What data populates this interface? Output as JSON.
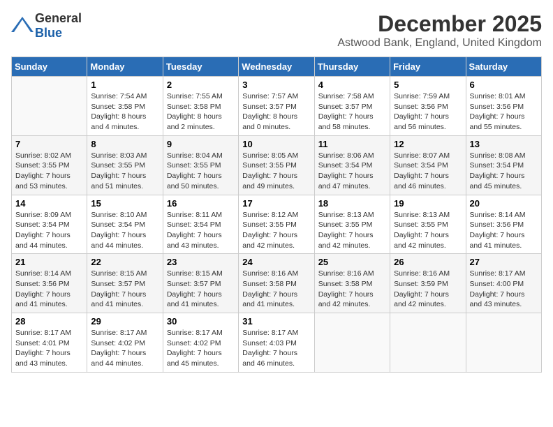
{
  "logo": {
    "general": "General",
    "blue": "Blue"
  },
  "title": {
    "month": "December 2025",
    "location": "Astwood Bank, England, United Kingdom"
  },
  "headers": [
    "Sunday",
    "Monday",
    "Tuesday",
    "Wednesday",
    "Thursday",
    "Friday",
    "Saturday"
  ],
  "rows": [
    [
      {
        "day": "",
        "info": ""
      },
      {
        "day": "1",
        "info": "Sunrise: 7:54 AM\nSunset: 3:58 PM\nDaylight: 8 hours\nand 4 minutes."
      },
      {
        "day": "2",
        "info": "Sunrise: 7:55 AM\nSunset: 3:58 PM\nDaylight: 8 hours\nand 2 minutes."
      },
      {
        "day": "3",
        "info": "Sunrise: 7:57 AM\nSunset: 3:57 PM\nDaylight: 8 hours\nand 0 minutes."
      },
      {
        "day": "4",
        "info": "Sunrise: 7:58 AM\nSunset: 3:57 PM\nDaylight: 7 hours\nand 58 minutes."
      },
      {
        "day": "5",
        "info": "Sunrise: 7:59 AM\nSunset: 3:56 PM\nDaylight: 7 hours\nand 56 minutes."
      },
      {
        "day": "6",
        "info": "Sunrise: 8:01 AM\nSunset: 3:56 PM\nDaylight: 7 hours\nand 55 minutes."
      }
    ],
    [
      {
        "day": "7",
        "info": "Sunrise: 8:02 AM\nSunset: 3:55 PM\nDaylight: 7 hours\nand 53 minutes."
      },
      {
        "day": "8",
        "info": "Sunrise: 8:03 AM\nSunset: 3:55 PM\nDaylight: 7 hours\nand 51 minutes."
      },
      {
        "day": "9",
        "info": "Sunrise: 8:04 AM\nSunset: 3:55 PM\nDaylight: 7 hours\nand 50 minutes."
      },
      {
        "day": "10",
        "info": "Sunrise: 8:05 AM\nSunset: 3:55 PM\nDaylight: 7 hours\nand 49 minutes."
      },
      {
        "day": "11",
        "info": "Sunrise: 8:06 AM\nSunset: 3:54 PM\nDaylight: 7 hours\nand 47 minutes."
      },
      {
        "day": "12",
        "info": "Sunrise: 8:07 AM\nSunset: 3:54 PM\nDaylight: 7 hours\nand 46 minutes."
      },
      {
        "day": "13",
        "info": "Sunrise: 8:08 AM\nSunset: 3:54 PM\nDaylight: 7 hours\nand 45 minutes."
      }
    ],
    [
      {
        "day": "14",
        "info": "Sunrise: 8:09 AM\nSunset: 3:54 PM\nDaylight: 7 hours\nand 44 minutes."
      },
      {
        "day": "15",
        "info": "Sunrise: 8:10 AM\nSunset: 3:54 PM\nDaylight: 7 hours\nand 44 minutes."
      },
      {
        "day": "16",
        "info": "Sunrise: 8:11 AM\nSunset: 3:54 PM\nDaylight: 7 hours\nand 43 minutes."
      },
      {
        "day": "17",
        "info": "Sunrise: 8:12 AM\nSunset: 3:55 PM\nDaylight: 7 hours\nand 42 minutes."
      },
      {
        "day": "18",
        "info": "Sunrise: 8:13 AM\nSunset: 3:55 PM\nDaylight: 7 hours\nand 42 minutes."
      },
      {
        "day": "19",
        "info": "Sunrise: 8:13 AM\nSunset: 3:55 PM\nDaylight: 7 hours\nand 42 minutes."
      },
      {
        "day": "20",
        "info": "Sunrise: 8:14 AM\nSunset: 3:56 PM\nDaylight: 7 hours\nand 41 minutes."
      }
    ],
    [
      {
        "day": "21",
        "info": "Sunrise: 8:14 AM\nSunset: 3:56 PM\nDaylight: 7 hours\nand 41 minutes."
      },
      {
        "day": "22",
        "info": "Sunrise: 8:15 AM\nSunset: 3:57 PM\nDaylight: 7 hours\nand 41 minutes."
      },
      {
        "day": "23",
        "info": "Sunrise: 8:15 AM\nSunset: 3:57 PM\nDaylight: 7 hours\nand 41 minutes."
      },
      {
        "day": "24",
        "info": "Sunrise: 8:16 AM\nSunset: 3:58 PM\nDaylight: 7 hours\nand 41 minutes."
      },
      {
        "day": "25",
        "info": "Sunrise: 8:16 AM\nSunset: 3:58 PM\nDaylight: 7 hours\nand 42 minutes."
      },
      {
        "day": "26",
        "info": "Sunrise: 8:16 AM\nSunset: 3:59 PM\nDaylight: 7 hours\nand 42 minutes."
      },
      {
        "day": "27",
        "info": "Sunrise: 8:17 AM\nSunset: 4:00 PM\nDaylight: 7 hours\nand 43 minutes."
      }
    ],
    [
      {
        "day": "28",
        "info": "Sunrise: 8:17 AM\nSunset: 4:01 PM\nDaylight: 7 hours\nand 43 minutes."
      },
      {
        "day": "29",
        "info": "Sunrise: 8:17 AM\nSunset: 4:02 PM\nDaylight: 7 hours\nand 44 minutes."
      },
      {
        "day": "30",
        "info": "Sunrise: 8:17 AM\nSunset: 4:02 PM\nDaylight: 7 hours\nand 45 minutes."
      },
      {
        "day": "31",
        "info": "Sunrise: 8:17 AM\nSunset: 4:03 PM\nDaylight: 7 hours\nand 46 minutes."
      },
      {
        "day": "",
        "info": ""
      },
      {
        "day": "",
        "info": ""
      },
      {
        "day": "",
        "info": ""
      }
    ]
  ]
}
